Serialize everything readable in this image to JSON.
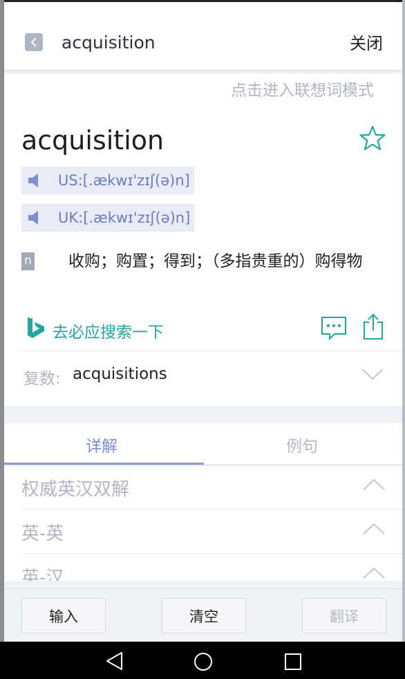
{
  "header": {
    "title": "acquisition",
    "close_label": "关闭"
  },
  "entry": {
    "association_hint": "点击进入联想词模式",
    "word": "acquisition",
    "pronunciations": [
      {
        "text": "US:[.ækwɪ'zɪʃ(ə)n]"
      },
      {
        "text": "UK:[.ækwɪ'zɪʃ(ə)n]"
      }
    ],
    "definitions": [
      {
        "pos": "n",
        "meaning": "收购；购置；得到；（多指贵重的）购得物"
      }
    ],
    "bing_search_label": "去必应搜索一下",
    "plural_label": "复数:",
    "plural_value": "acquisitions"
  },
  "tabs": [
    {
      "label": "详解",
      "active": true
    },
    {
      "label": "例句",
      "active": false
    }
  ],
  "sections": [
    {
      "label": "权威英汉双解"
    },
    {
      "label": "英-英"
    },
    {
      "label": "英-汉"
    }
  ],
  "bottom_buttons": {
    "input": "输入",
    "clear": "清空",
    "translate": "翻译"
  },
  "colors": {
    "accent_teal": "#22a6a0",
    "tab_active": "#7d8ed2",
    "pron_text": "#6c7cc2",
    "pron_bg": "#e9ecf7"
  },
  "icons": {
    "back": "chevron-left-icon",
    "favorite": "star-outline-icon",
    "speaker": "speaker-icon",
    "bing": "bing-logo-icon",
    "comment": "comment-icon",
    "share": "share-icon",
    "expand": "chevron-down-icon",
    "collapse": "chevron-up-icon"
  }
}
